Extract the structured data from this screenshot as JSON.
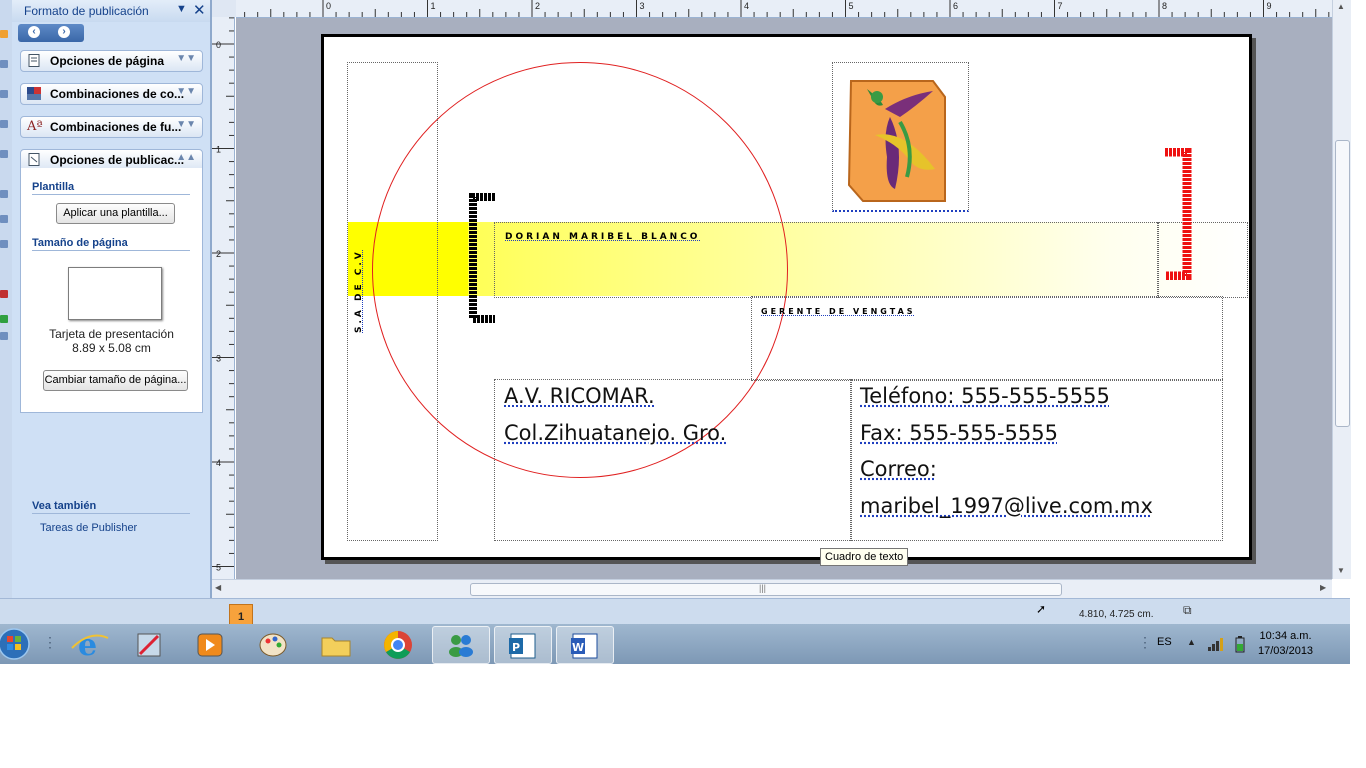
{
  "task_pane": {
    "title": "Formato de publicación",
    "sections": [
      {
        "label": "Opciones de página"
      },
      {
        "label": "Combinaciones de co..."
      },
      {
        "label": "Combinaciones de fu..."
      },
      {
        "label": "Opciones de publicac..."
      }
    ],
    "template_heading": "Plantilla",
    "apply_template_button": "Aplicar una plantilla...",
    "page_size_heading": "Tamaño de página",
    "page_type": "Tarjeta de presentación",
    "page_dims": "8.89 x 5.08 cm",
    "change_size_button": "Cambiar tamaño de página...",
    "see_also_heading": "Vea también",
    "tasks_link": "Tareas de Publisher"
  },
  "ruler": {
    "horizontal_labels": [
      "0",
      "1",
      "2",
      "3",
      "4",
      "5",
      "6",
      "7",
      "8",
      "9"
    ],
    "vertical_labels": [
      "0",
      "1",
      "2",
      "3",
      "4",
      "5"
    ]
  },
  "card": {
    "name": "DORIAN MARIBEL BLANCO",
    "title": "GERENTE DE VENGTAS",
    "company_suffix": "S.A DE C.V",
    "address_line1": "A.V. RICOMAR.",
    "address_line2": "Col.Zihuatanejo. Gro.",
    "phone": "Teléfono: 555-555-5555",
    "fax": "Fax: 555-555-5555",
    "email_label": "Correo:",
    "email": "maribel_1997@live.com.mx"
  },
  "tooltip": "Cuadro de texto",
  "status": {
    "page_number": "1",
    "coordinates": "4.810, 4.725 cm."
  },
  "taskbar": {
    "language": "ES",
    "time": "10:34 a.m.",
    "date": "17/03/2013"
  },
  "colors": {
    "accent_yellow": "#ffff00",
    "circle_red": "#e02020",
    "bracket_red": "#ee1111",
    "pane_blue": "#15428b"
  }
}
